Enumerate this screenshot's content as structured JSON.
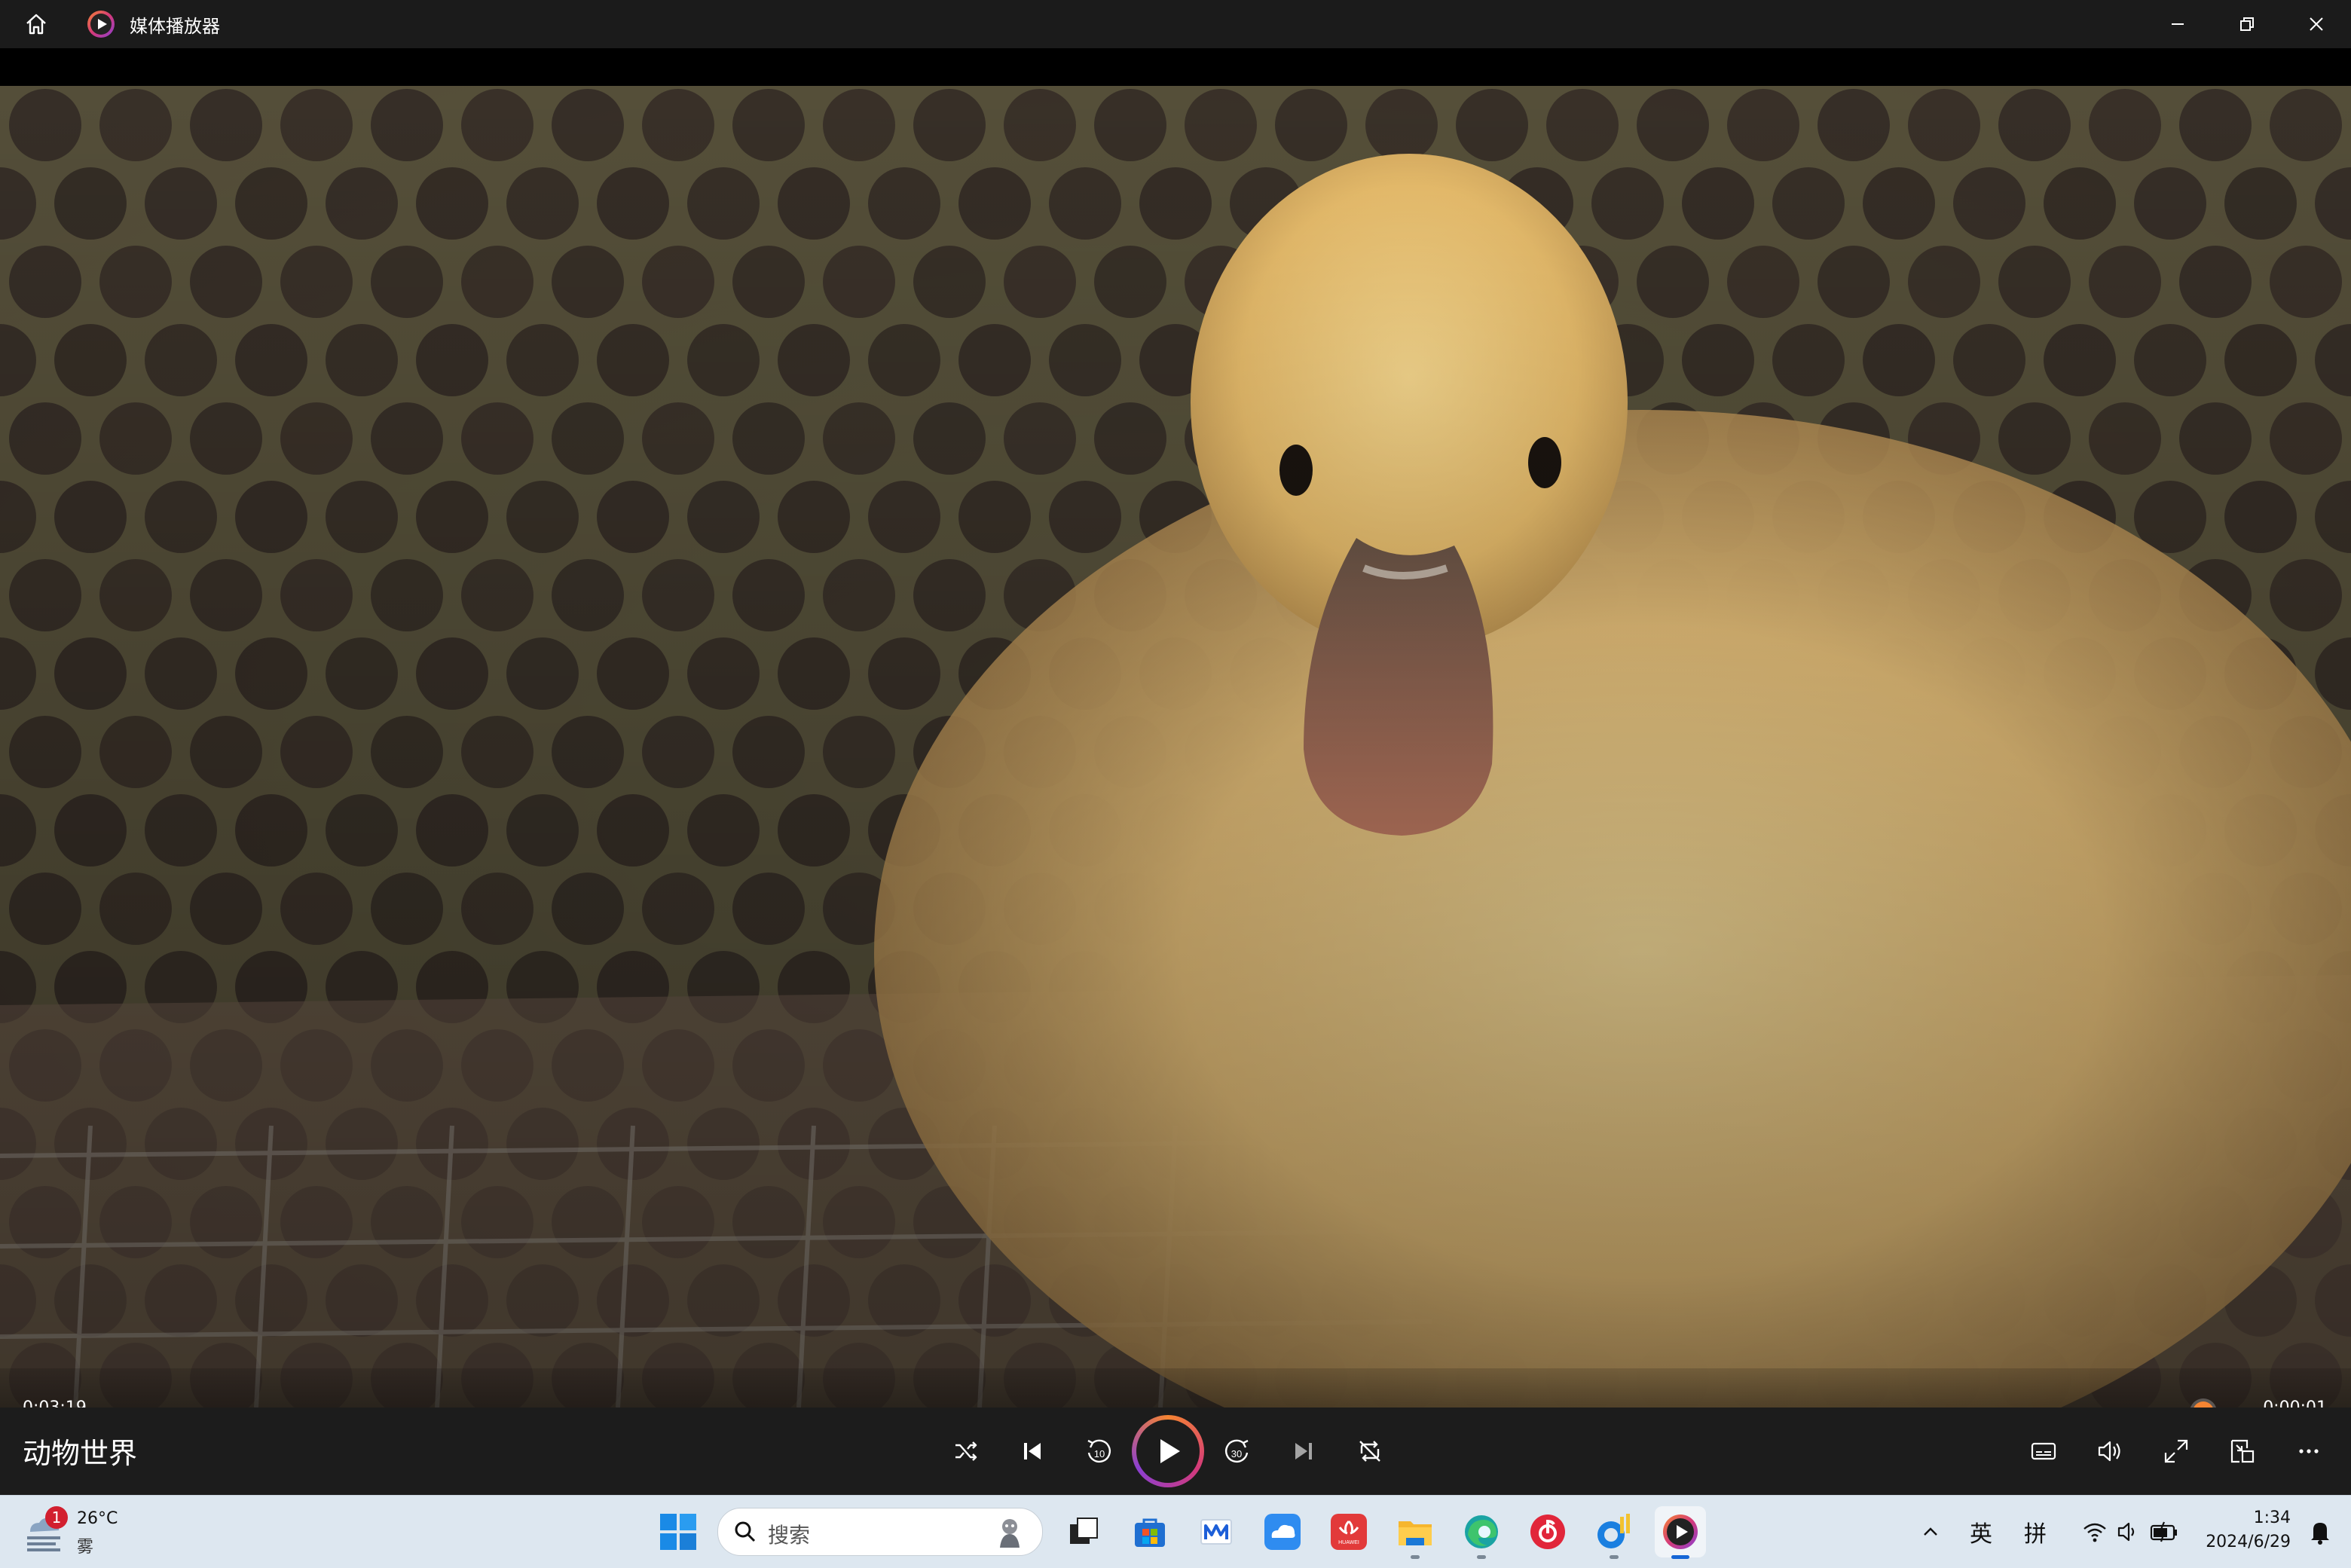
{
  "window": {
    "title": "媒体播放器",
    "icons": [
      "home-icon",
      "media-player-app-icon",
      "minimize-icon",
      "restore-icon",
      "close-icon"
    ]
  },
  "player": {
    "media_title": "动物世界",
    "elapsed": "0:03:19",
    "remaining": "0:00:01",
    "progress_fraction": 0.998,
    "accent_color": "#f58432",
    "center_controls": [
      "shuffle-icon",
      "previous-icon",
      "rewind-10-icon",
      "play-icon",
      "forward-30-icon",
      "next-icon",
      "repeat-off-icon"
    ],
    "right_controls": [
      "subtitles-icon",
      "volume-icon",
      "fullscreen-icon",
      "mini-player-icon",
      "more-icon"
    ],
    "rewind_label": "10",
    "forward_label": "30"
  },
  "taskbar": {
    "weather": {
      "badge": "1",
      "temperature": "26°C",
      "condition": "雾"
    },
    "search_placeholder": "搜索",
    "tray": {
      "ime_lang": "英",
      "ime_mode": "拼"
    },
    "clock": {
      "time": "1:34",
      "date": "2024/6/29"
    },
    "apps": [
      "start-icon",
      "task-view-icon",
      "store-icon",
      "mail-icon",
      "onedrive-icon",
      "huawei-app-icon",
      "file-explorer-icon",
      "edge-icon",
      "music-app-icon",
      "chart-app-icon",
      "media-player-icon"
    ],
    "huawei_label": "HUAWEI"
  }
}
